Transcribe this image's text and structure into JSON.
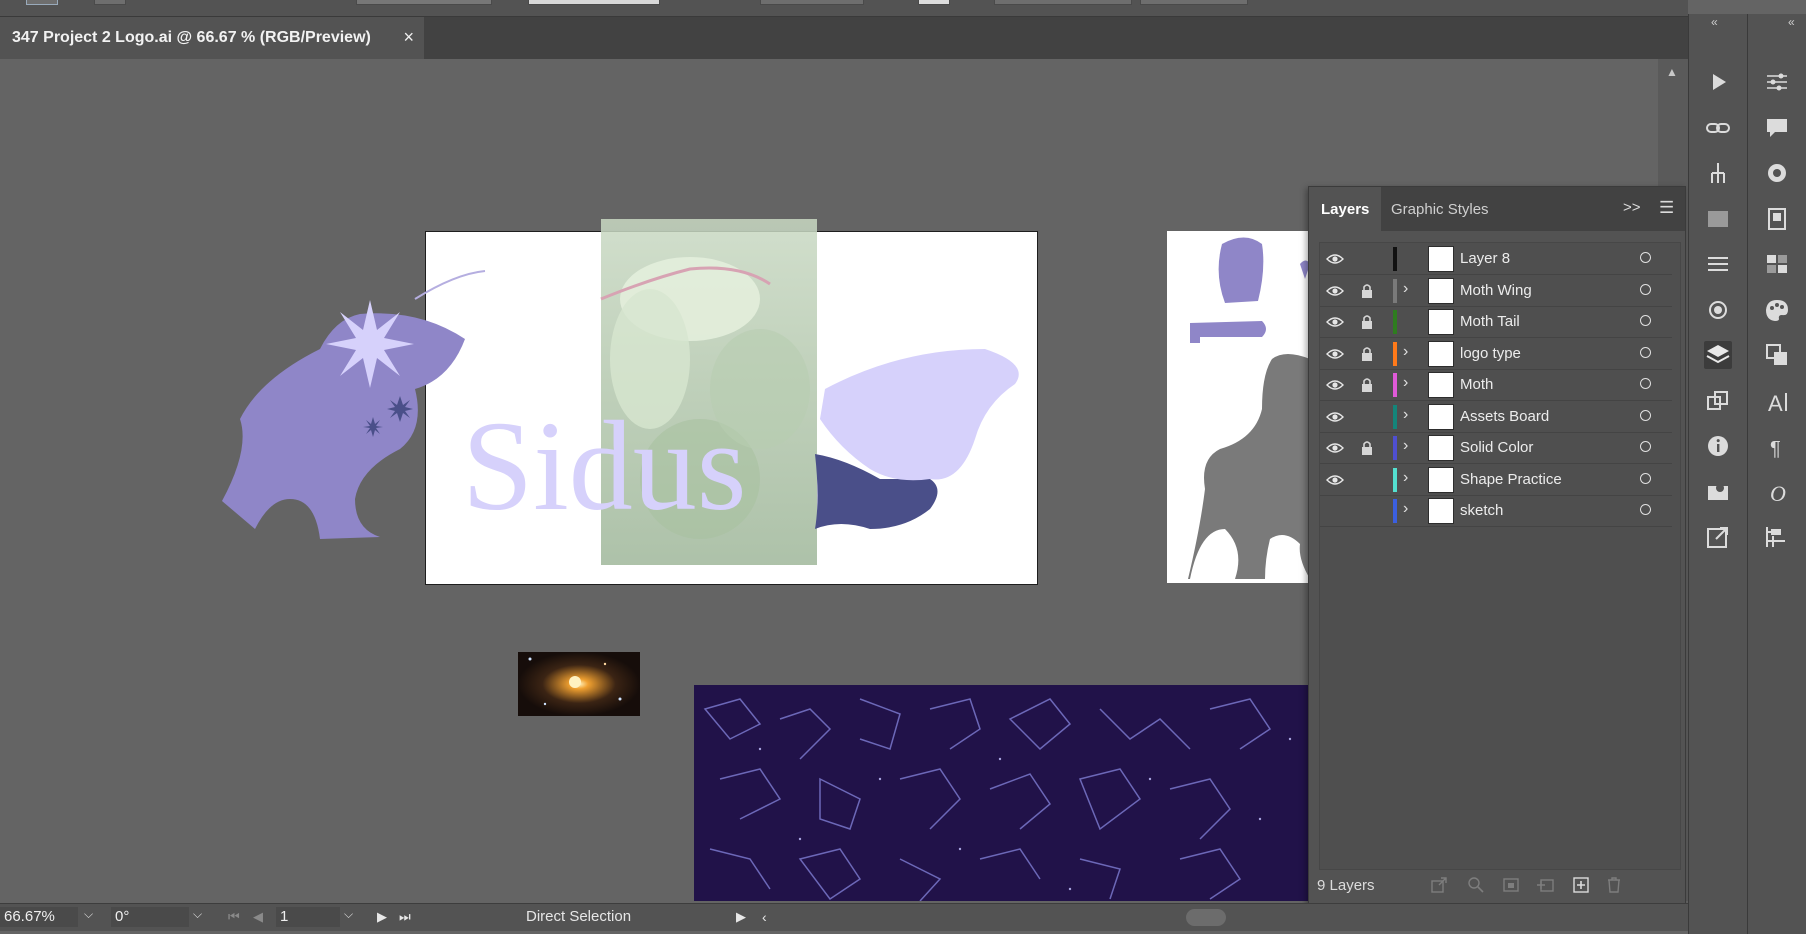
{
  "document": {
    "tab_title": "347 Project 2 Logo.ai @ 66.67 % (RGB/Preview)",
    "close_label": "×"
  },
  "artwork": {
    "logo_text": "Sidus",
    "colors": {
      "lavender": "#8f86c8",
      "light_lavender": "#d6d1fb",
      "navy_wing": "#4a4f89",
      "gray_shape": "#7a7a7a",
      "night_sky": "#211249",
      "constellation": "#6c68b8"
    }
  },
  "layers_panel": {
    "tabs": [
      "Layers",
      "Graphic Styles"
    ],
    "collapse_label": ">>",
    "layers": [
      {
        "name": "Layer 8",
        "visible": true,
        "locked": false,
        "expandable": false,
        "color": "#111111"
      },
      {
        "name": "Moth Wing",
        "visible": true,
        "locked": true,
        "expandable": true,
        "color": "#7a7a7a"
      },
      {
        "name": "Moth Tail",
        "visible": true,
        "locked": true,
        "expandable": false,
        "color": "#2e7d1f"
      },
      {
        "name": "logo type",
        "visible": true,
        "locked": true,
        "expandable": true,
        "color": "#ff7a1a"
      },
      {
        "name": "Moth",
        "visible": true,
        "locked": true,
        "expandable": true,
        "color": "#e05ad8"
      },
      {
        "name": "Assets Board",
        "visible": true,
        "locked": false,
        "expandable": true,
        "color": "#14857a"
      },
      {
        "name": "Solid Color",
        "visible": true,
        "locked": true,
        "expandable": true,
        "color": "#4f4fd0"
      },
      {
        "name": "Shape Practice",
        "visible": true,
        "locked": false,
        "expandable": true,
        "color": "#54e0d0"
      },
      {
        "name": "sketch",
        "visible": false,
        "locked": false,
        "expandable": true,
        "color": "#3b5fe0"
      }
    ],
    "layer_count": "9 Layers"
  },
  "statusbar": {
    "zoom": "66.67%",
    "rotation": "0°",
    "artboard_number": "1",
    "current_tool": "Direct Selection"
  },
  "right_panels": {
    "col1_icons": [
      "play-icon",
      "link-icon",
      "puppet-warp-icon",
      "gradient-icon",
      "stroke-icon",
      "appearance-icon",
      "layers-icon",
      "transform-icon",
      "info-icon",
      "export-icon",
      "share-icon"
    ],
    "col2_icons": [
      "properties-icon",
      "comments-icon",
      "color-guide-icon",
      "libraries-icon",
      "swatches-icon",
      "color-icon",
      "pathfinder-icon",
      "character-icon",
      "paragraph-icon",
      "opentype-icon",
      "align-icon"
    ]
  }
}
